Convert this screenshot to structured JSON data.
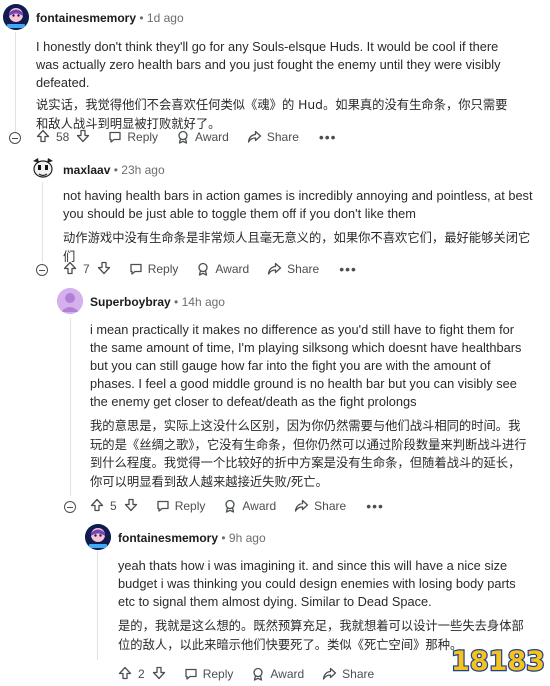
{
  "comments": [
    {
      "username": "fontainesmemory",
      "time": "1d ago",
      "text_en": "I honestly don't think they'll go for any Souls-elsque Huds. It would be cool if there was actually zero health bars and you just fought the enemy until they were visibly defeated.",
      "text_cn": "说实话，我觉得他们不会喜欢任何类似《魂》的 Hud。如果真的没有生命条，你只需要和敌人战斗到明显被打败就好了。",
      "votes": "58"
    },
    {
      "username": "maxlaav",
      "time": "23h ago",
      "text_en": "not having health bars in action games is incredibly annoying and pointless, at best you should be just able to toggle them off if you don't like them",
      "text_cn": "动作游戏中没有生命条是非常烦人且毫无意义的，如果你不喜欢它们，最好能够关闭它们",
      "votes": "7"
    },
    {
      "username": "Superboybray",
      "time": "14h ago",
      "text_en": "i mean practically it makes no difference as you'd still have to fight them for the same amount of time, I'm playing silksong which doesnt have healthbars but you can still gauge how far into the fight you are with the amount of phases. I feel a good middle ground is no health bar but you can visibly see the enemy get closer to defeat/death as the fight prolongs",
      "text_cn": "我的意思是，实际上这没什么区别，因为你仍然需要与他们战斗相同的时间。我玩的是《丝绸之歌》，它没有生命条，但你仍然可以通过阶段数量来判断战斗进行到什么程度。我觉得一个比较好的折中方案是没有生命条，但随着战斗的延长，你可以明显看到敌人越来越接近失败/死亡。",
      "votes": "5"
    },
    {
      "username": "fontainesmemory",
      "time": "9h ago",
      "text_en": "yeah thats how i was imagining it. and since this will have a nice size budget i was thinking you could design enemies with losing body parts etc to signal them almost dying. Similar to Dead Space.",
      "text_cn": "是的，我就是这么想的。既然预算充足，我就想着可以设计一些失去身体部位的敌人，以此来暗示他们快要死了。类似《死亡空间》那种。",
      "votes": "2"
    }
  ],
  "actions": {
    "reply": "Reply",
    "award": "Award",
    "share": "Share",
    "more": "•••"
  },
  "watermark": {
    "text": "18183"
  },
  "colors": {
    "upvote": "#4a4f52",
    "thread_line": "#e0e3e5",
    "username": "#1c1c1c",
    "muted": "#6b6f72"
  }
}
